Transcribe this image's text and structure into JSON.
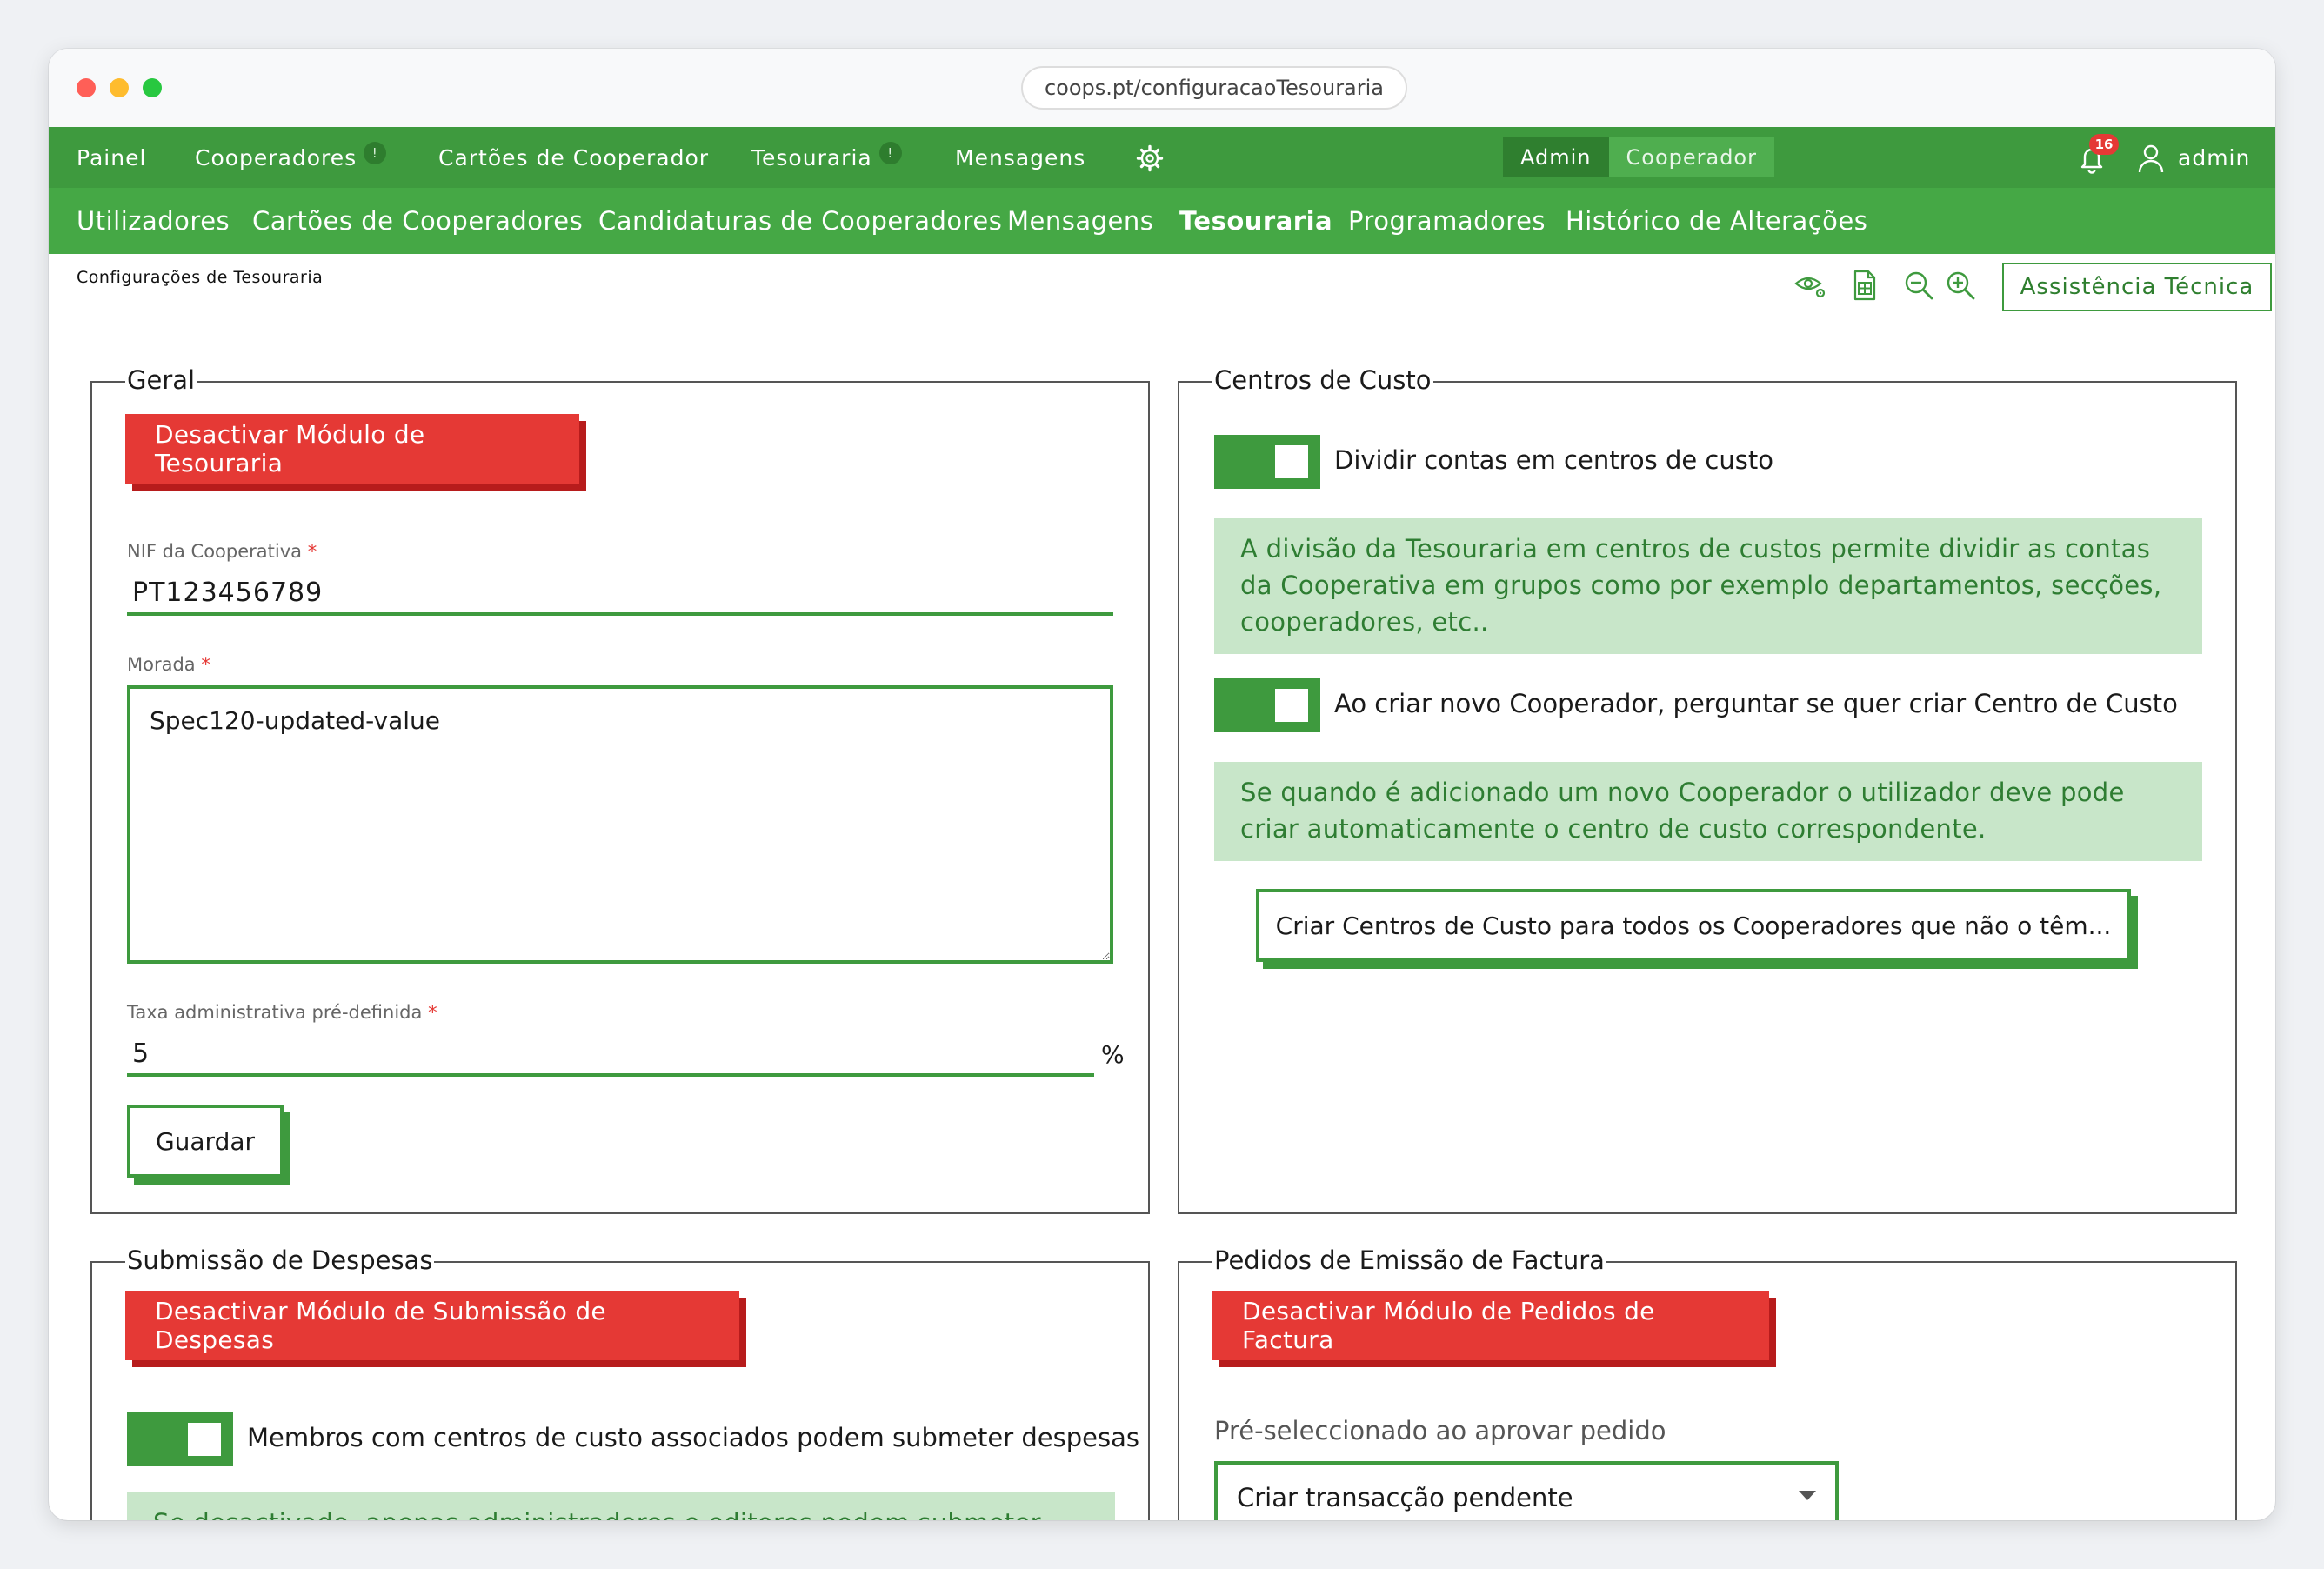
{
  "browser": {
    "url": "coops.pt/configuracaoTesouraria"
  },
  "topnav": {
    "items": [
      {
        "label": "Painel"
      },
      {
        "label": "Cooperadores",
        "badge": "!"
      },
      {
        "label": "Cartões de Cooperador"
      },
      {
        "label": "Tesouraria",
        "badge": "!"
      },
      {
        "label": "Mensagens"
      }
    ],
    "settings_icon": "gear-icon",
    "roles": {
      "admin": "Admin",
      "cooperador": "Cooperador",
      "active": "Admin"
    },
    "notifications_count": "16",
    "user": "admin"
  },
  "subnav": {
    "items": [
      {
        "label": "Utilizadores"
      },
      {
        "label": "Cartões de Cooperadores"
      },
      {
        "label": "Candidaturas de Cooperadores"
      },
      {
        "label": "Mensagens"
      },
      {
        "label": "Tesouraria",
        "active": true
      },
      {
        "label": "Programadores"
      },
      {
        "label": "Histórico de Alterações"
      }
    ]
  },
  "breadcrumb": "Configurações de Tesouraria",
  "toolbar": {
    "icons": [
      "eye-settings-icon",
      "spreadsheet-icon",
      "zoom-out-icon",
      "zoom-in-icon"
    ],
    "assist_label": "Assistência Técnica"
  },
  "geral": {
    "legend": "Geral",
    "deactivate_label": "Desactivar Módulo de Tesouraria",
    "nif": {
      "label": "NIF da Cooperativa",
      "required": "*",
      "value": "PT123456789"
    },
    "morada": {
      "label": "Morada",
      "required": "*",
      "value": "Spec120-updated-value"
    },
    "taxa": {
      "label": "Taxa administrativa pré-definida",
      "required": "*",
      "value": "5",
      "unit": "%"
    },
    "save_label": "Guardar"
  },
  "centros": {
    "legend": "Centros de Custo",
    "toggle1": {
      "label": "Dividir contas em centros de custo",
      "on": true
    },
    "info1": "A divisão da Tesouraria em centros de custos permite dividir as contas da Cooperativa em grupos como por exemplo departamentos, secções, cooperadores, etc..",
    "toggle2": {
      "label": "Ao criar novo Cooperador, perguntar se quer criar Centro de Custo",
      "on": true
    },
    "info2": "Se quando é adicionado um novo Cooperador o utilizador deve pode criar automaticamente o centro de custo correspondente.",
    "create_label": "Criar Centros de Custo para todos os Cooperadores que não o têm..."
  },
  "despesas": {
    "legend": "Submissão de Despesas",
    "deactivate_label": "Desactivar Módulo de Submissão de Despesas",
    "toggle": {
      "label": "Membros com centros de custo associados podem submeter despesas",
      "on": true
    },
    "info": "Se desactivado, apenas administradores e editores podem submeter despesas."
  },
  "facturas": {
    "legend": "Pedidos de Emissão de Factura",
    "deactivate_label": "Desactivar Módulo de Pedidos de Factura",
    "select_label": "Pré-seleccionado ao aprovar pedido",
    "select_value": "Criar transacção pendente"
  },
  "colors": {
    "primary": "#3e9a3e",
    "subnav": "#45a845",
    "danger": "#e53935",
    "info_bg": "#c8e6c9",
    "info_text": "#2e7d32"
  }
}
